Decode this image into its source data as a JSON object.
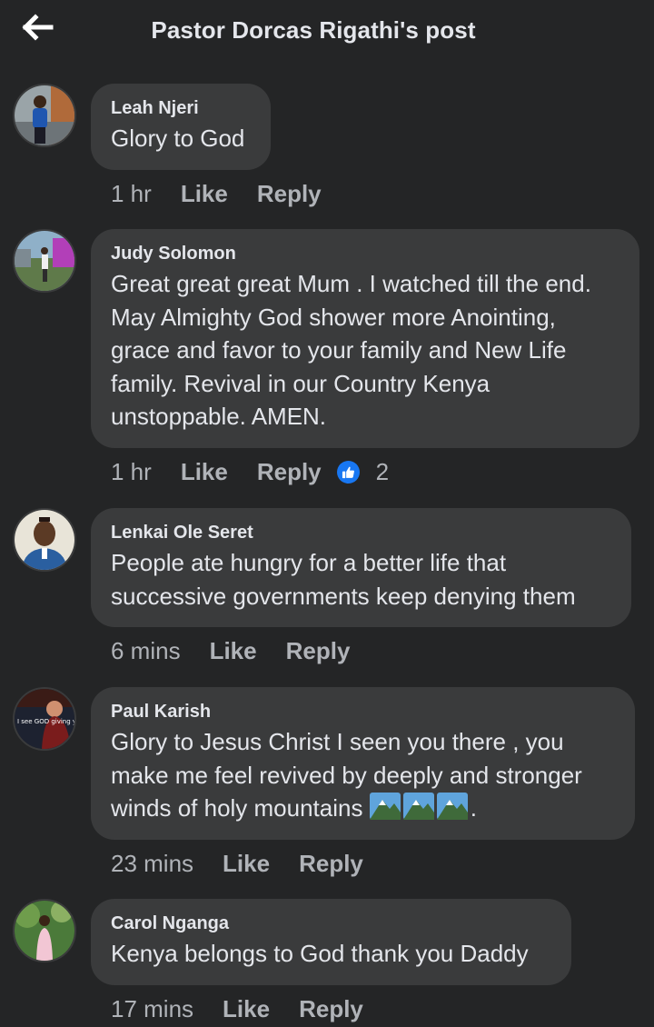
{
  "header": {
    "title": "Pastor Dorcas Rigathi's post"
  },
  "actions": {
    "like": "Like",
    "reply": "Reply"
  },
  "comments": [
    {
      "author": "Leah Njeri",
      "text": "Glory to God",
      "time": "1 hr"
    },
    {
      "author": "Judy Solomon",
      "text": "Great great great Mum . I watched till the end. May Almighty God shower more Anointing, grace and favor to your family and New Life family. Revival in our Country Kenya unstoppable. AMEN.",
      "time": "1 hr",
      "reactions": "2"
    },
    {
      "author": "Lenkai Ole Seret",
      "text": "People ate hungry for a better life that successive governments keep denying them",
      "time": "6 mins"
    },
    {
      "author": "Paul Karish",
      "text": "Glory to Jesus Christ I seen you there , you make me feel revived by deeply and stronger winds of holy mountains",
      "text_suffix": ".",
      "time": "23 mins",
      "avatar_caption": "I see GOD giving you victory over your"
    },
    {
      "author": "Carol Nganga",
      "text": "Kenya belongs to God thank you Daddy",
      "time": "17 mins"
    }
  ],
  "colors": {
    "background": "#242526",
    "bubble": "#3a3b3c",
    "text": "#e4e6eb",
    "secondary": "#b0b3b8",
    "like_blue": "#1877f2"
  },
  "icons": {
    "back": "arrow-left-icon",
    "reaction": "like-thumb-icon",
    "emoji": "snow-mountain-icon"
  }
}
